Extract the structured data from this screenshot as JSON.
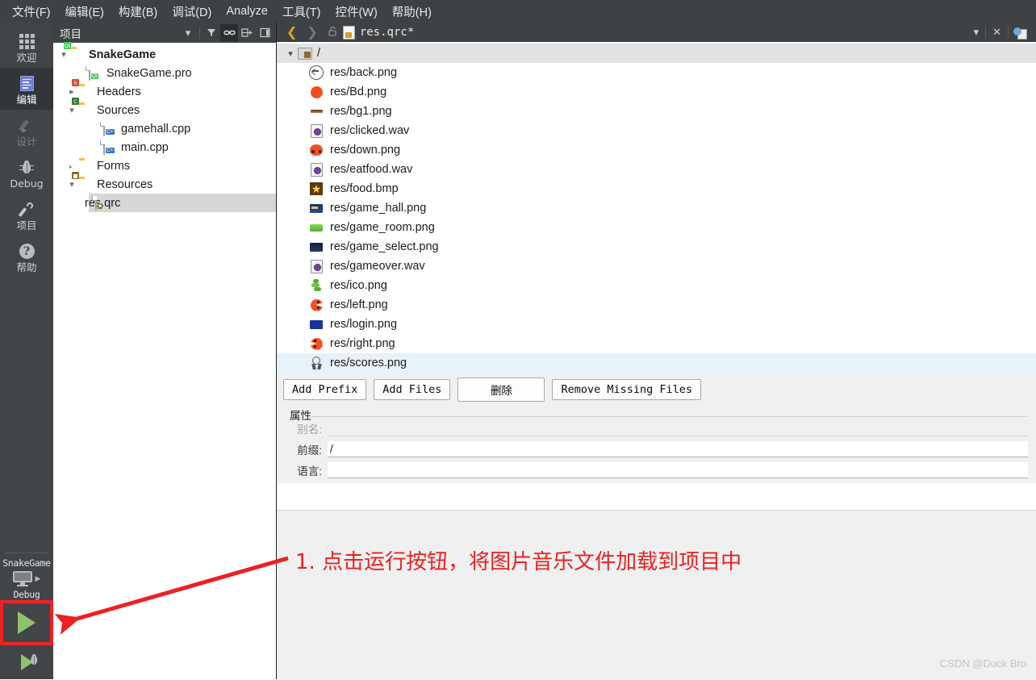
{
  "menubar": {
    "items": [
      {
        "label": "文件(F)",
        "name": "menu-file"
      },
      {
        "label": "编辑(E)",
        "name": "menu-edit"
      },
      {
        "label": "构建(B)",
        "name": "menu-build"
      },
      {
        "label": "调试(D)",
        "name": "menu-debug"
      },
      {
        "label": "Analyze",
        "name": "menu-analyze"
      },
      {
        "label": "工具(T)",
        "name": "menu-tools"
      },
      {
        "label": "控件(W)",
        "name": "menu-window"
      },
      {
        "label": "帮助(H)",
        "name": "menu-help"
      }
    ]
  },
  "modebar": {
    "items": [
      {
        "label": "欢迎",
        "icon": "grid-icon",
        "state": "normal"
      },
      {
        "label": "编辑",
        "icon": "document-icon",
        "state": "active"
      },
      {
        "label": "设计",
        "icon": "pencil-icon",
        "state": "disabled"
      },
      {
        "label": "Debug",
        "icon": "bug-icon",
        "state": "normal"
      },
      {
        "label": "项目",
        "icon": "wrench-icon",
        "state": "normal"
      },
      {
        "label": "帮助",
        "icon": "question-icon",
        "state": "normal"
      }
    ],
    "kit": {
      "project_name": "SnakeGame",
      "build_config": "Debug",
      "run_button_label": "",
      "debug_button_label": ""
    }
  },
  "project_panel": {
    "header": {
      "title": "项目",
      "dropdown_icon": "chevron-down-icon",
      "filter_icon": "filter-icon",
      "link_icon": "link-icon",
      "collapse_icon": "collapse-all-icon",
      "hide_icon": "hide-sidebar-icon"
    },
    "tree": [
      {
        "label": "SnakeGame",
        "depth": 0,
        "chevron": "v",
        "icon": "folder-qt",
        "bold": true,
        "selected": false
      },
      {
        "label": "SnakeGame.pro",
        "depth": 1,
        "chevron": "",
        "icon": "file-qt",
        "bold": false,
        "selected": false
      },
      {
        "label": "Headers",
        "depth": 1,
        "chevron": ">",
        "icon": "folder-h",
        "bold": false,
        "selected": false
      },
      {
        "label": "Sources",
        "depth": 1,
        "chevron": "v",
        "icon": "folder-cpp",
        "bold": false,
        "selected": false
      },
      {
        "label": "gamehall.cpp",
        "depth": 2,
        "chevron": "",
        "icon": "file-cpp",
        "bold": false,
        "selected": false
      },
      {
        "label": "main.cpp",
        "depth": 2,
        "chevron": "",
        "icon": "file-cpp",
        "bold": false,
        "selected": false
      },
      {
        "label": "Forms",
        "depth": 1,
        "chevron": ">",
        "icon": "folder-forms",
        "bold": false,
        "selected": false
      },
      {
        "label": "Resources",
        "depth": 1,
        "chevron": "v",
        "icon": "folder-res",
        "bold": false,
        "selected": false
      },
      {
        "label": "res.qrc",
        "depth": 2,
        "chevron": "",
        "icon": "file-qrc",
        "bold": false,
        "selected": true
      }
    ]
  },
  "editor": {
    "toolbar": {
      "back_icon": "chevron-left-icon",
      "forward_icon": "chevron-right-icon",
      "lock_icon": "unlock-icon",
      "file_icon": "qrc-file-icon",
      "filename": "res.qrc*",
      "dropdown_icon": "chevron-down-icon",
      "close_icon": "close-icon",
      "split_icon": "split-editor-icon"
    },
    "resource_tree": {
      "root": {
        "label": "/",
        "chevron": "v",
        "icon": "qrc-folder-icon"
      },
      "files": [
        {
          "label": "res/back.png",
          "icon": "back-arrow-circle",
          "selected": false
        },
        {
          "label": "res/Bd.png",
          "icon": "orange-circle",
          "selected": false
        },
        {
          "label": "res/bg1.png",
          "icon": "brown-bar",
          "selected": false
        },
        {
          "label": "res/clicked.wav",
          "icon": "wav-file",
          "selected": false
        },
        {
          "label": "res/down.png",
          "icon": "orange-head-down",
          "selected": false
        },
        {
          "label": "res/eatfood.wav",
          "icon": "wav-file",
          "selected": false
        },
        {
          "label": "res/food.bmp",
          "icon": "yellow-star",
          "selected": false
        },
        {
          "label": "res/game_hall.png",
          "icon": "hall-thumb",
          "selected": false
        },
        {
          "label": "res/game_room.png",
          "icon": "green-thumb",
          "selected": false
        },
        {
          "label": "res/game_select.png",
          "icon": "dark-thumb",
          "selected": false
        },
        {
          "label": "res/gameover.wav",
          "icon": "wav-file",
          "selected": false
        },
        {
          "label": "res/ico.png",
          "icon": "green-snake",
          "selected": false
        },
        {
          "label": "res/left.png",
          "icon": "pac-left",
          "selected": false
        },
        {
          "label": "res/login.png",
          "icon": "blue-thumb",
          "selected": false
        },
        {
          "label": "res/right.png",
          "icon": "pac-right",
          "selected": false
        },
        {
          "label": "res/scores.png",
          "icon": "medal-icon",
          "selected": true
        }
      ]
    },
    "buttons": [
      {
        "label": "Add Prefix",
        "name": "add-prefix-button"
      },
      {
        "label": "Add Files",
        "name": "add-files-button"
      },
      {
        "label": "删除",
        "name": "remove-button"
      },
      {
        "label": "Remove Missing Files",
        "name": "remove-missing-files-button"
      }
    ],
    "properties": {
      "group_title": "属性",
      "fields": [
        {
          "label": "别名:",
          "value": "",
          "disabled": true,
          "name": "alias-field"
        },
        {
          "label": "前缀:",
          "value": "/",
          "disabled": false,
          "name": "prefix-field"
        },
        {
          "label": "语言:",
          "value": "",
          "disabled": false,
          "name": "language-field"
        }
      ]
    }
  },
  "annotation": {
    "text": "1. 点击运行按钮，将图片音乐文件加载到项目中",
    "color": "#ee2020"
  },
  "watermark": {
    "text": "CSDN @Duck Bro"
  },
  "colors": {
    "menubar_bg": "#3f4244",
    "modebar_bg": "#424548",
    "active_mode_bg": "#333638",
    "selection_blue": "#e5f1fb",
    "selection_gray": "#d6d6d6",
    "panel_bg": "#f0f0f0",
    "highlight_red": "#ee2222",
    "run_green": "#8ec26b"
  }
}
